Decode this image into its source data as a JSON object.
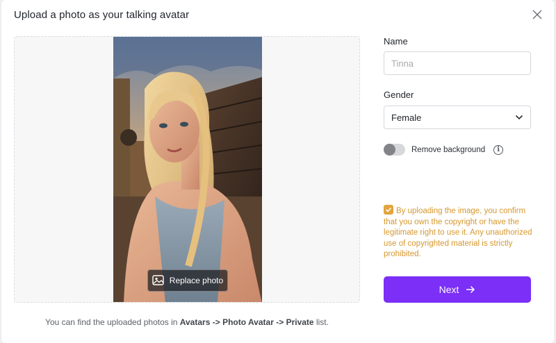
{
  "dialog": {
    "title": "Upload a photo as your talking avatar"
  },
  "preview": {
    "replace_label": "Replace photo"
  },
  "hint": {
    "prefix": "You can find the uploaded photos in",
    "avatars": "Avatars",
    "arrow1": "->",
    "photo_avatar": "Photo Avatar",
    "arrow2": "->",
    "private": "Private",
    "suffix": "list."
  },
  "form": {
    "name_label": "Name",
    "name_placeholder": "Tinna",
    "gender_label": "Gender",
    "gender_value": "Female",
    "remove_bg_label": "Remove background",
    "remove_bg_on": false,
    "consent_text": "By uploading the image, you confirm that you own the copyright or have the legitimate right to use it. Any unauthorized use of copyrighted material is strictly prohibited.",
    "consent_checked": true,
    "next_label": "Next"
  },
  "colors": {
    "accent": "#7b2ff7",
    "consent": "#d6972e",
    "checkbox": "#e2a43e"
  }
}
